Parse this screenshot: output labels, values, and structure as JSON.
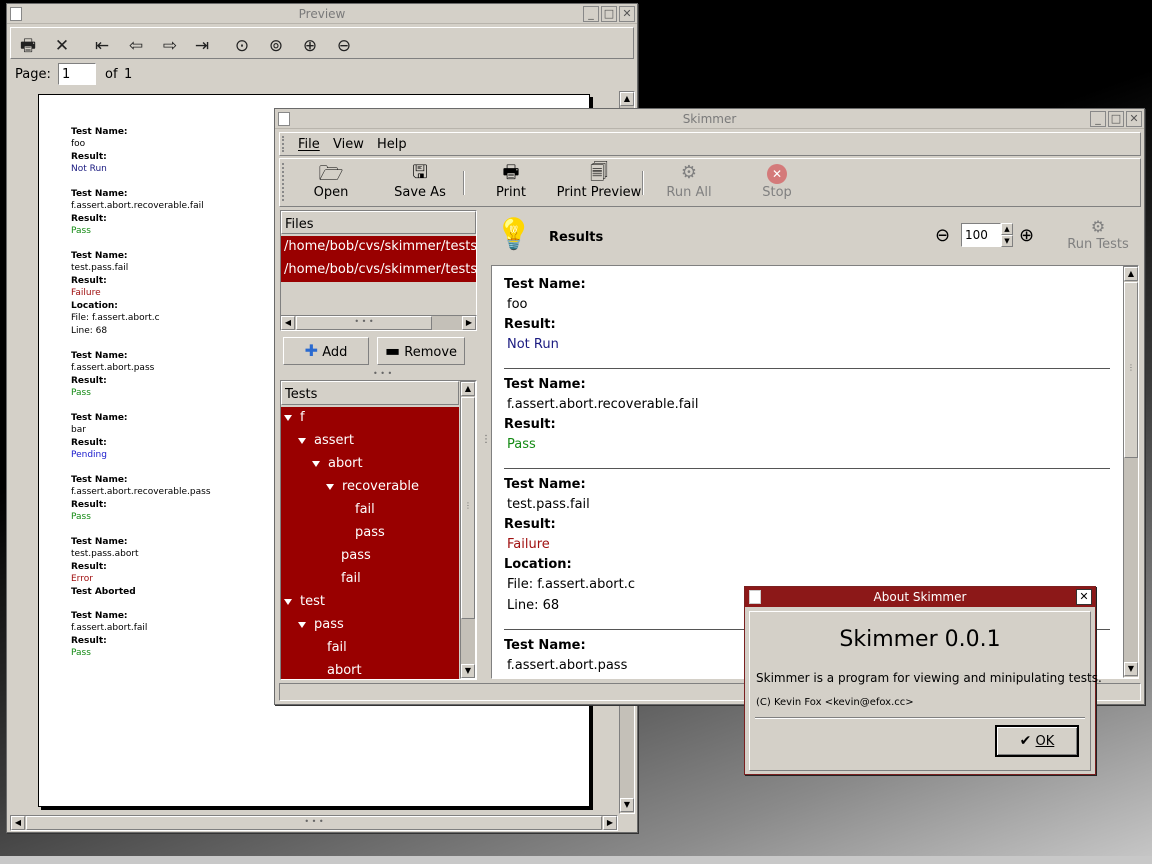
{
  "preview": {
    "title": "Preview",
    "page_label": "Page:",
    "page_value": "1",
    "of_label": "of",
    "total_pages": "1",
    "toolbar_icons": [
      "printer-icon",
      "close-icon",
      "first-page-icon",
      "prev-page-icon",
      "next-page-icon",
      "last-page-icon",
      "zoom-100-icon",
      "zoom-fit-icon",
      "zoom-in-icon",
      "zoom-out-icon"
    ],
    "entries": [
      {
        "name_label": "Test Name:",
        "name": "foo",
        "result_label": "Result:",
        "result": "Not Run"
      },
      {
        "name_label": "Test Name:",
        "name": "f.assert.abort.recoverable.fail",
        "result_label": "Result:",
        "result": "Pass"
      },
      {
        "name_label": "Test Name:",
        "name": "test.pass.fail",
        "result_label": "Result:",
        "result": "Failure",
        "location_label": "Location:",
        "file": "File:  f.assert.abort.c",
        "line": "Line: 68"
      },
      {
        "name_label": "Test Name:",
        "name": "f.assert.abort.pass",
        "result_label": "Result:",
        "result": "Pass"
      },
      {
        "name_label": "Test Name:",
        "name": "bar",
        "result_label": "Result:",
        "result": "Pending"
      },
      {
        "name_label": "Test Name:",
        "name": "f.assert.abort.recoverable.pass",
        "result_label": "Result:",
        "result": "Pass"
      },
      {
        "name_label": "Test Name:",
        "name": "test.pass.abort",
        "result_label": "Result:",
        "result": "Error",
        "aborted": "Test Aborted"
      },
      {
        "name_label": "Test Name:",
        "name": "f.assert.abort.fail",
        "result_label": "Result:",
        "result": "Pass"
      }
    ]
  },
  "skimmer": {
    "title": "Skimmer",
    "menu": [
      "File",
      "View",
      "Help"
    ],
    "toolbar": [
      {
        "label": "Open",
        "icon": "folder-open-icon"
      },
      {
        "label": "Save As",
        "icon": "save-icon"
      },
      {
        "label": "Print",
        "icon": "printer-icon"
      },
      {
        "label": "Print Preview",
        "icon": "print-preview-icon"
      },
      {
        "label": "Run All",
        "icon": "gears-icon"
      },
      {
        "label": "Stop",
        "icon": "stop-icon"
      }
    ],
    "files_header": "Files",
    "files": [
      "/home/bob/cvs/skimmer/tests/foo",
      "/home/bob/cvs/skimmer/tests/foo"
    ],
    "add_label": "Add",
    "remove_label": "Remove",
    "tests_header": "Tests",
    "tree": [
      {
        "label": "f",
        "indent": 0,
        "expander": true
      },
      {
        "label": "assert",
        "indent": 1,
        "expander": true
      },
      {
        "label": "abort",
        "indent": 2,
        "expander": true
      },
      {
        "label": "recoverable",
        "indent": 3,
        "expander": true
      },
      {
        "label": "fail",
        "indent": 4,
        "expander": false
      },
      {
        "label": "pass",
        "indent": 4,
        "expander": false
      },
      {
        "label": "pass",
        "indent": 3,
        "expander": false
      },
      {
        "label": "fail",
        "indent": 3,
        "expander": false
      },
      {
        "label": "test",
        "indent": 0,
        "expander": true
      },
      {
        "label": "pass",
        "indent": 1,
        "expander": true
      },
      {
        "label": "fail",
        "indent": 2,
        "expander": false
      },
      {
        "label": "abort",
        "indent": 2,
        "expander": false
      }
    ],
    "results_title": "Results",
    "zoom_value": "100",
    "run_tests_label": "Run Tests",
    "results": [
      {
        "name_label": "Test Name:",
        "name": "foo",
        "result_label": "Result:",
        "result": "Not Run"
      },
      {
        "name_label": "Test Name:",
        "name": "f.assert.abort.recoverable.fail",
        "result_label": "Result:",
        "result": "Pass"
      },
      {
        "name_label": "Test Name:",
        "name": "test.pass.fail",
        "result_label": "Result:",
        "result": "Failure",
        "location_label": "Location:",
        "file": "File:  f.assert.abort.c",
        "line": "Line: 68"
      },
      {
        "name_label": "Test Name:",
        "name": "f.assert.abort.pass"
      }
    ]
  },
  "about": {
    "title": "About Skimmer",
    "app_name": "Skimmer 0.0.1",
    "description": "Skimmer is a program for viewing and minipulating tests.",
    "copyright": "(C) Kevin Fox <kevin@efox.cc>",
    "ok_label": "OK"
  },
  "colors": {
    "selection": "#990000",
    "window": "#d4d0c8",
    "pass": "#138a13",
    "failure": "#a01010",
    "not_run": "#1a1a80"
  }
}
